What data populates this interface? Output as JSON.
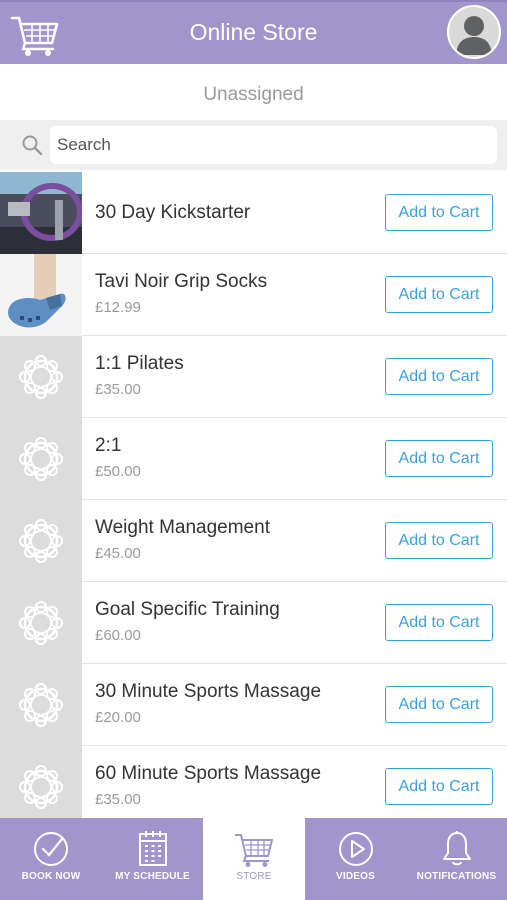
{
  "colors": {
    "brand": "#a195cc",
    "accent": "#3aa0d8"
  },
  "header": {
    "title": "Online Store",
    "logo_icon": "shopping-cart-icon",
    "avatar_icon": "user-avatar-icon"
  },
  "subtitle": "Unassigned",
  "search": {
    "placeholder": "Search",
    "value": ""
  },
  "products": [
    {
      "name": "30 Day Kickstarter",
      "price": "",
      "thumb": "photo-pilates-ring",
      "button": "Add to Cart"
    },
    {
      "name": "Tavi Noir Grip Socks",
      "price": "£12.99",
      "thumb": "photo-grip-socks",
      "button": "Add to Cart"
    },
    {
      "name": "1:1 Pilates",
      "price": "£35.00",
      "thumb": "placeholder-logo",
      "button": "Add to Cart"
    },
    {
      "name": "2:1",
      "price": "£50.00",
      "thumb": "placeholder-logo",
      "button": "Add to Cart"
    },
    {
      "name": "Weight Management",
      "price": "£45.00",
      "thumb": "placeholder-logo",
      "button": "Add to Cart"
    },
    {
      "name": "Goal Specific Training",
      "price": "£60.00",
      "thumb": "placeholder-logo",
      "button": "Add to Cart"
    },
    {
      "name": "30 Minute Sports Massage",
      "price": "£20.00",
      "thumb": "placeholder-logo",
      "button": "Add to Cart"
    },
    {
      "name": "60 Minute Sports Massage",
      "price": "£35.00",
      "thumb": "placeholder-logo",
      "button": "Add to Cart"
    }
  ],
  "nav": [
    {
      "label": "BOOK NOW",
      "icon": "check-circle-icon",
      "active": false
    },
    {
      "label": "MY SCHEDULE",
      "icon": "calendar-icon",
      "active": false
    },
    {
      "label": "STORE",
      "icon": "shopping-cart-icon",
      "active": true
    },
    {
      "label": "VIDEOS",
      "icon": "play-circle-icon",
      "active": false
    },
    {
      "label": "NOTIFICATIONS",
      "icon": "bell-icon",
      "active": false
    }
  ]
}
